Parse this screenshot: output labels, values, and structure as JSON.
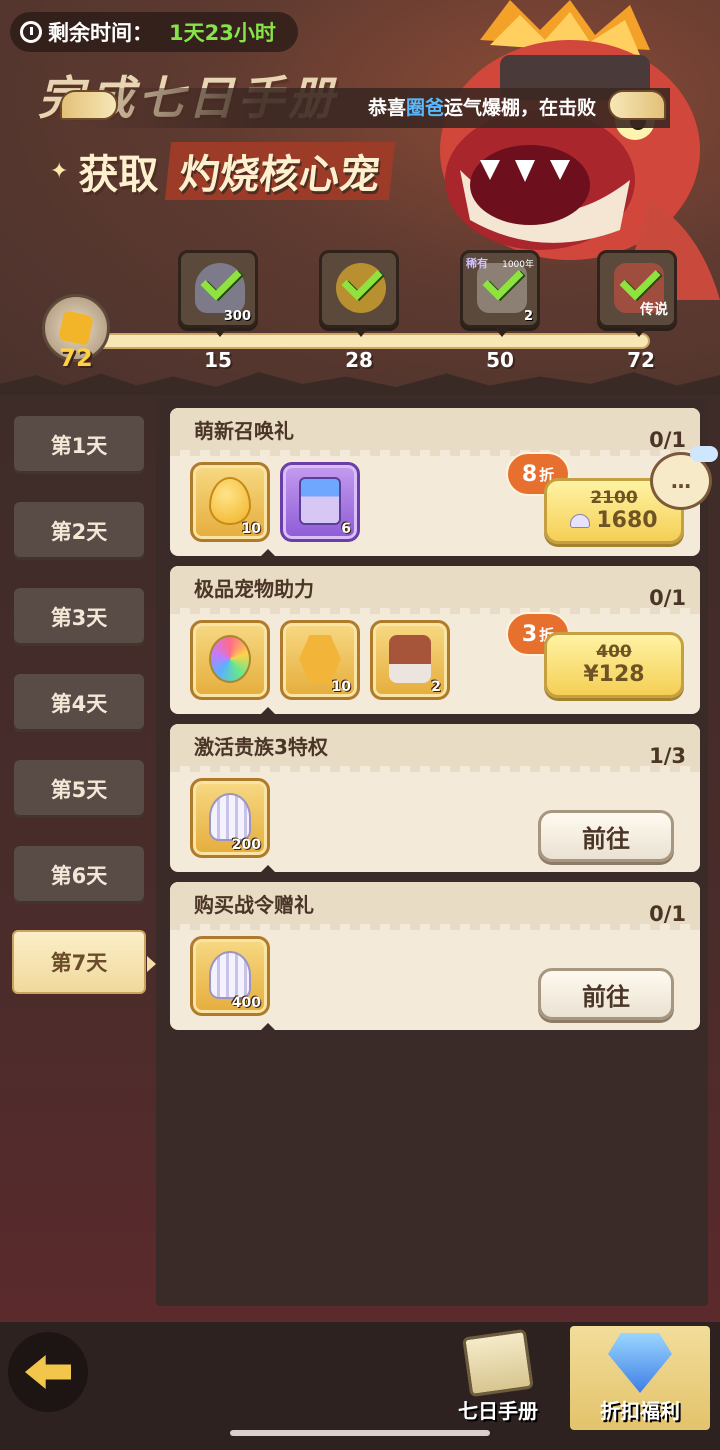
{
  "header": {
    "timer_label": "剩余时间：",
    "timer_value": "1天23小时",
    "title_line1": "完成七日手册",
    "title_line2_a": "获取",
    "title_line2_b": "灼烧核心宠",
    "marquee_prefix": "恭喜",
    "marquee_name": "圈爸",
    "marquee_suffix": "运气爆棚，在击败"
  },
  "progress": {
    "current": "72",
    "milestones": [
      {
        "value": "15",
        "qty": "300",
        "icon": "shell-dark-icon",
        "claimed": true
      },
      {
        "value": "28",
        "qty": "",
        "icon": "egg-icon",
        "claimed": true
      },
      {
        "value": "50",
        "qty": "2",
        "icon": "chest-icon",
        "claimed": true,
        "tag": "稀有",
        "tag2": "1000年"
      },
      {
        "value": "72",
        "qty": "",
        "icon": "dragon-pet-icon",
        "claimed": true,
        "tag3": "传说"
      }
    ]
  },
  "days": [
    {
      "label": "第1天",
      "active": false
    },
    {
      "label": "第2天",
      "active": false
    },
    {
      "label": "第3天",
      "active": false
    },
    {
      "label": "第4天",
      "active": false
    },
    {
      "label": "第5天",
      "active": false
    },
    {
      "label": "第6天",
      "active": false
    },
    {
      "label": "第7天",
      "active": true
    }
  ],
  "tasks": [
    {
      "title": "萌新召唤礼",
      "progress": "0/1",
      "items": [
        {
          "icon": "golden-egg-icon",
          "qty": "10"
        },
        {
          "icon": "berry-box-icon",
          "qty": "6"
        }
      ],
      "discount_num": "8",
      "discount_unit": "折",
      "old_price": "2100",
      "new_price": "1680",
      "currency_icon": "shell-icon"
    },
    {
      "title": "极品宠物助力",
      "progress": "0/1",
      "items": [
        {
          "icon": "rainbow-orb-icon",
          "qty": ""
        },
        {
          "icon": "paw-coin-icon",
          "qty": "10"
        },
        {
          "icon": "meat-basket-icon",
          "qty": "2"
        }
      ],
      "discount_num": "3",
      "discount_unit": "折",
      "old_price": "400",
      "new_price": "¥128"
    },
    {
      "title": "激活贵族3特权",
      "progress": "1/3",
      "items": [
        {
          "icon": "shell-icon",
          "qty": "200"
        }
      ],
      "button": "前往"
    },
    {
      "title": "购买战令赠礼",
      "progress": "0/1",
      "items": [
        {
          "icon": "shell-icon",
          "qty": "400"
        }
      ],
      "button": "前往"
    }
  ],
  "chat": {
    "label": "…"
  },
  "bottom_nav": {
    "back_icon": "back-arrow-icon",
    "tabs": [
      {
        "label": "七日手册",
        "icon": "book-icon",
        "active": false
      },
      {
        "label": "折扣福利",
        "icon": "gem-icon",
        "active": true
      }
    ]
  },
  "colors": {
    "accent": "#f4cf55",
    "discount": "#e8702e",
    "check": "#8fe33f",
    "timer_value": "#86e34a"
  }
}
